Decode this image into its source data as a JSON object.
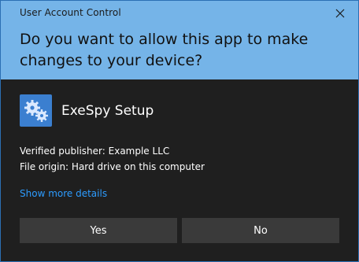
{
  "window": {
    "title": "User Account Control",
    "close_icon": "close-icon"
  },
  "prompt": {
    "question": "Do you want to allow this app to make changes to your device?"
  },
  "app": {
    "icon": "gears-icon",
    "name": "ExeSpy Setup",
    "publisher_line": "Verified publisher: Example LLC",
    "origin_line": "File origin: Hard drive on this computer"
  },
  "links": {
    "show_details": "Show more details"
  },
  "buttons": {
    "yes": "Yes",
    "no": "No"
  },
  "colors": {
    "header_bg": "#75b4e8",
    "body_bg": "#1f1f1f",
    "link": "#2d9cff",
    "button_bg": "#3a3a3a"
  }
}
